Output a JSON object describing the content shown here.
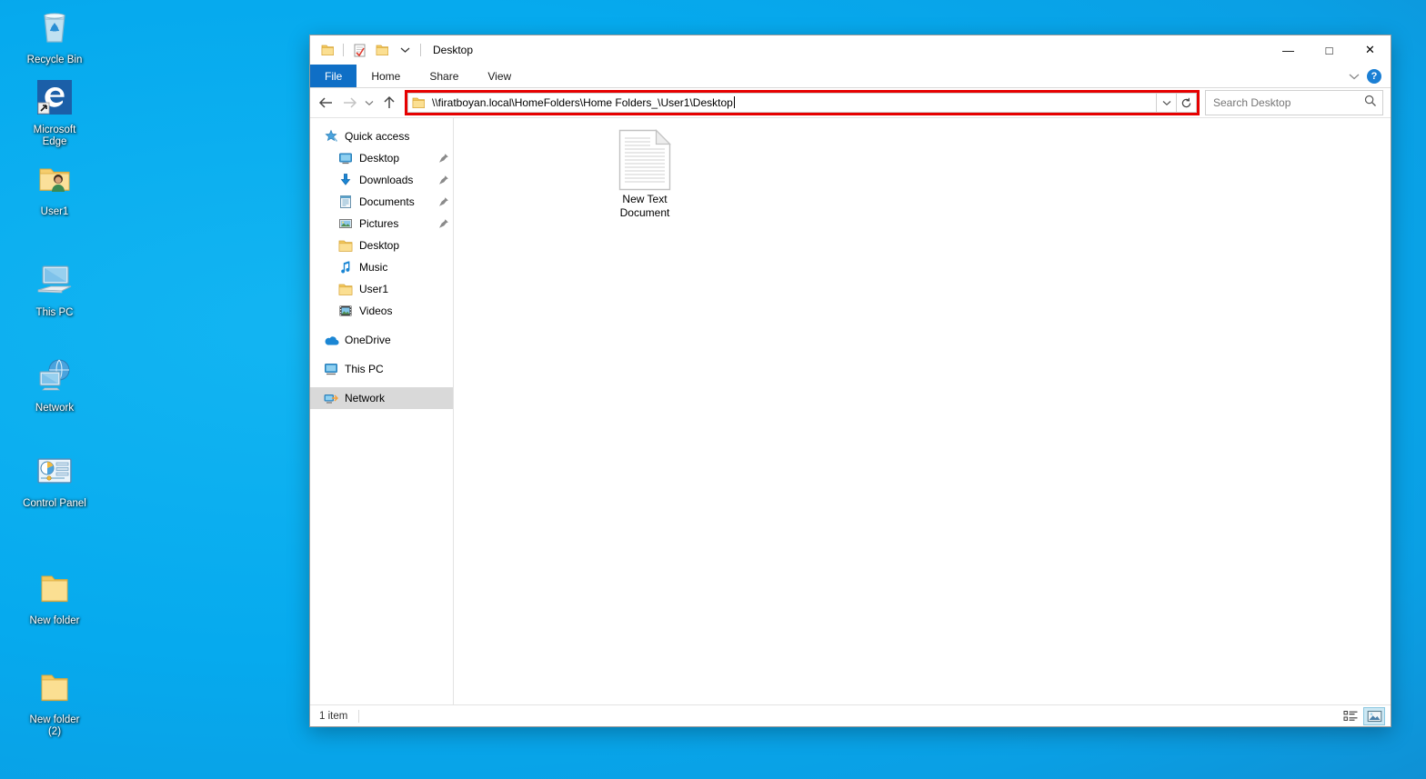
{
  "desktop": {
    "background_color": "#06aaee",
    "icons": [
      {
        "label": "Recycle Bin",
        "icon": "recycle-bin-icon",
        "name": "desktop-icon-recycle-bin"
      },
      {
        "label": "Microsoft\nEdge",
        "icon": "microsoft-edge-icon",
        "name": "desktop-icon-microsoft-edge",
        "shortcut": true
      },
      {
        "label": "User1",
        "icon": "user-folder-icon",
        "name": "desktop-icon-user1"
      },
      {
        "label": "This PC",
        "icon": "this-pc-icon",
        "name": "desktop-icon-this-pc"
      },
      {
        "label": "Network",
        "icon": "network-icon",
        "name": "desktop-icon-network"
      },
      {
        "label": "Control Panel",
        "icon": "control-panel-icon",
        "name": "desktop-icon-control-panel"
      },
      {
        "label": "New folder",
        "icon": "folder-icon",
        "name": "desktop-icon-new-folder"
      },
      {
        "label": "New folder\n(2)",
        "icon": "folder-icon",
        "name": "desktop-icon-new-folder-2"
      }
    ]
  },
  "window": {
    "title": "Desktop",
    "quick_access_toolbar": [
      {
        "icon": "folder-icon",
        "name": "qat-folder-icon"
      },
      {
        "icon": "properties-icon",
        "name": "qat-properties-icon"
      },
      {
        "icon": "new-folder-icon",
        "name": "qat-new-folder-icon"
      },
      {
        "icon": "chevron-down-icon",
        "name": "qat-customize-icon"
      }
    ],
    "controls": {
      "minimize": "—",
      "maximize": "□",
      "close": "✕"
    }
  },
  "ribbon": {
    "tabs": [
      {
        "label": "File",
        "active": true
      },
      {
        "label": "Home",
        "active": false
      },
      {
        "label": "Share",
        "active": false
      },
      {
        "label": "View",
        "active": false
      }
    ],
    "collapse_icon": "chevron-down-icon",
    "help_label": "?"
  },
  "navigation": {
    "back_icon": "arrow-left-icon",
    "forward_icon": "arrow-right-icon",
    "recent_icon": "chevron-down-icon",
    "up_icon": "arrow-up-icon",
    "address": {
      "value": "\\\\firatboyan.local\\HomeFolders\\Home Folders_\\User1\\Desktop",
      "folder_icon": "folder-icon",
      "dropdown_icon": "chevron-down-icon",
      "refresh_icon": "refresh-icon",
      "highlight_color": "#e60000",
      "focused": true
    },
    "search": {
      "placeholder": "Search Desktop",
      "icon": "search-icon"
    }
  },
  "sidebar": {
    "items": [
      {
        "label": "Quick access",
        "icon": "star-pin-icon",
        "level": 0,
        "pinned": false,
        "selected": false
      },
      {
        "label": "Desktop",
        "icon": "desktop-monitor-icon",
        "level": 1,
        "pinned": true,
        "selected": false
      },
      {
        "label": "Downloads",
        "icon": "download-arrow-icon",
        "level": 1,
        "pinned": true,
        "selected": false
      },
      {
        "label": "Documents",
        "icon": "documents-icon",
        "level": 1,
        "pinned": true,
        "selected": false
      },
      {
        "label": "Pictures",
        "icon": "pictures-icon",
        "level": 1,
        "pinned": true,
        "selected": false
      },
      {
        "label": "Desktop",
        "icon": "folder-icon",
        "level": 1,
        "pinned": false,
        "selected": false
      },
      {
        "label": "Music",
        "icon": "music-note-icon",
        "level": 1,
        "pinned": false,
        "selected": false
      },
      {
        "label": "User1",
        "icon": "folder-icon",
        "level": 1,
        "pinned": false,
        "selected": false
      },
      {
        "label": "Videos",
        "icon": "videos-icon",
        "level": 1,
        "pinned": false,
        "selected": false
      },
      {
        "label": "OneDrive",
        "icon": "onedrive-cloud-icon",
        "level": 0,
        "pinned": false,
        "selected": false,
        "gap_before": true
      },
      {
        "label": "This PC",
        "icon": "this-pc-icon",
        "level": 0,
        "pinned": false,
        "selected": false,
        "gap_before": true
      },
      {
        "label": "Network",
        "icon": "network-icon",
        "level": 0,
        "pinned": false,
        "selected": true,
        "gap_before": true
      }
    ]
  },
  "content": {
    "files": [
      {
        "label": "New Text\nDocument",
        "icon": "text-document-icon"
      }
    ]
  },
  "statusbar": {
    "item_count": "1 item",
    "views": [
      {
        "icon": "details-view-icon",
        "name": "details-view-button",
        "active": false
      },
      {
        "icon": "large-icons-view-icon",
        "name": "large-icons-view-button",
        "active": true
      }
    ]
  }
}
